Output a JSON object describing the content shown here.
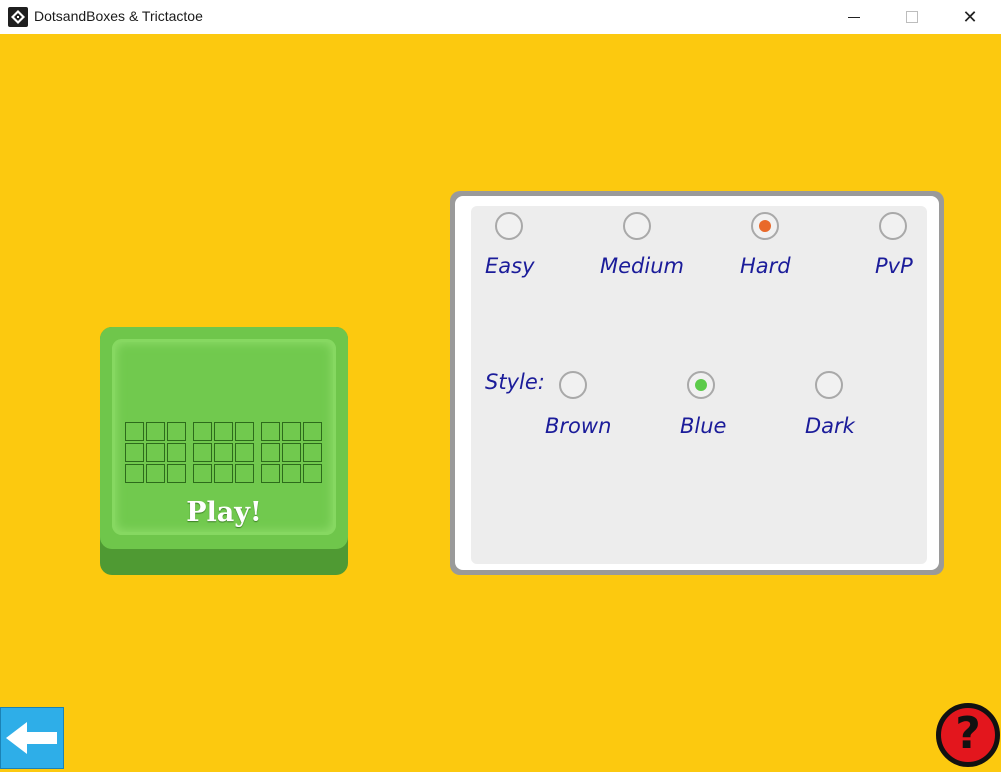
{
  "window": {
    "title": "DotsandBoxes & Trictactoe",
    "minimize_glyph": "",
    "close_glyph": "✕"
  },
  "play_button": {
    "label": "Play!"
  },
  "difficulty": {
    "options": [
      {
        "label": "Easy",
        "selected": false
      },
      {
        "label": "Medium",
        "selected": false
      },
      {
        "label": "Hard",
        "selected": true
      },
      {
        "label": "PvP",
        "selected": false
      }
    ],
    "selected_color": "#e9692a"
  },
  "style": {
    "label": "Style:",
    "options": [
      {
        "label": "Brown",
        "selected": false
      },
      {
        "label": "Blue",
        "selected": true
      },
      {
        "label": "Dark",
        "selected": false
      }
    ],
    "selected_color": "#5ccb4a"
  },
  "icons": {
    "back": "arrow-left-icon",
    "help": "question-mark-icon",
    "help_glyph": "?"
  },
  "colors": {
    "background": "#fcc90f",
    "play_green": "#6fc64b",
    "label_blue": "#1b1c9a",
    "back_blue": "#2eaee8",
    "help_red": "#e3161d"
  }
}
